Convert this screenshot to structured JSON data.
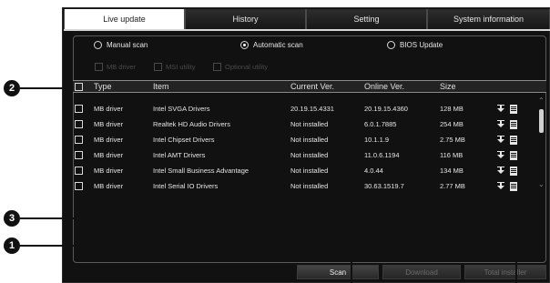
{
  "tabs": [
    {
      "label": "Live update",
      "active": true
    },
    {
      "label": "History",
      "active": false
    },
    {
      "label": "Setting",
      "active": false
    },
    {
      "label": "System information",
      "active": false
    }
  ],
  "scan_options": {
    "manual": "Manual scan",
    "automatic": "Automatic scan",
    "bios": "BIOS Update",
    "selected": "automatic"
  },
  "filters": {
    "mb_driver": "MB driver",
    "msi_utility": "MSI utility",
    "optional_utility": "Optional utility"
  },
  "table": {
    "headers": {
      "type": "Type",
      "item": "Item",
      "current": "Current Ver.",
      "online": "Online Ver.",
      "size": "Size"
    },
    "rows": [
      {
        "type": "MB driver",
        "item": "Intel SVGA Drivers",
        "current": "20.19.15.4331",
        "online": "20.19.15.4360",
        "size": "128 MB"
      },
      {
        "type": "MB driver",
        "item": "Realtek HD Audio Drivers",
        "current": "Not installed",
        "online": "6.0.1.7885",
        "size": "254 MB"
      },
      {
        "type": "MB driver",
        "item": "Intel Chipset Drivers",
        "current": "Not installed",
        "online": "10.1.1.9",
        "size": "2.75 MB"
      },
      {
        "type": "MB driver",
        "item": "Intel AMT Drivers",
        "current": "Not installed",
        "online": "11.0.6.1194",
        "size": "116 MB"
      },
      {
        "type": "MB driver",
        "item": "Intel Small Business Advantage",
        "current": "Not installed",
        "online": "4.0.44",
        "size": "134 MB"
      },
      {
        "type": "MB driver",
        "item": "Intel Serial IO Drivers",
        "current": "Not installed",
        "online": "30.63.1519.7",
        "size": "2.77 MB"
      }
    ]
  },
  "buttons": {
    "scan": "Scan",
    "download": "Download",
    "total_installer": "Total installer"
  },
  "callouts": {
    "one": "1",
    "two": "2",
    "three": "3"
  },
  "icons": {
    "download": "download-arrow-icon",
    "notes": "release-notes-icon"
  }
}
